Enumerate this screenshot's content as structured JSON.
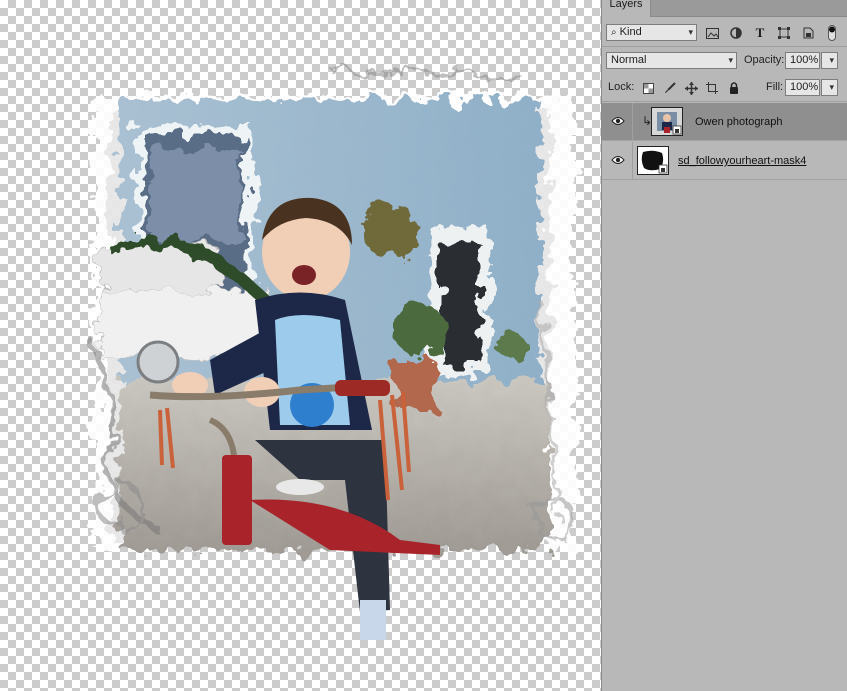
{
  "panel": {
    "tab_label": "Layers",
    "filter": {
      "value": "Kind",
      "icon": "search-icon"
    },
    "filter_icons": [
      "image-filter-icon",
      "adjustment-filter-icon",
      "type-filter-icon",
      "shape-filter-icon",
      "smart-object-filter-icon",
      "filter-toggle-icon"
    ],
    "blend_mode": "Normal",
    "opacity_label": "Opacity:",
    "opacity_value": "100%",
    "lock_label": "Lock:",
    "lock_icons": [
      "lock-transparent-icon",
      "lock-paint-icon",
      "lock-move-icon",
      "lock-artboard-icon",
      "lock-all-icon"
    ],
    "fill_label": "Fill:",
    "fill_value": "100%"
  },
  "layers": [
    {
      "name": "Owen photograph",
      "visible": true,
      "selected": true,
      "clipped": true
    },
    {
      "name": "sd_followyourheart-mask4",
      "visible": true,
      "selected": false,
      "clipped": false
    }
  ],
  "colors": {
    "panel_bg": "#b8b8b8",
    "selected_layer": "#8f8f8f",
    "tricycle_red": "#a8232a"
  }
}
